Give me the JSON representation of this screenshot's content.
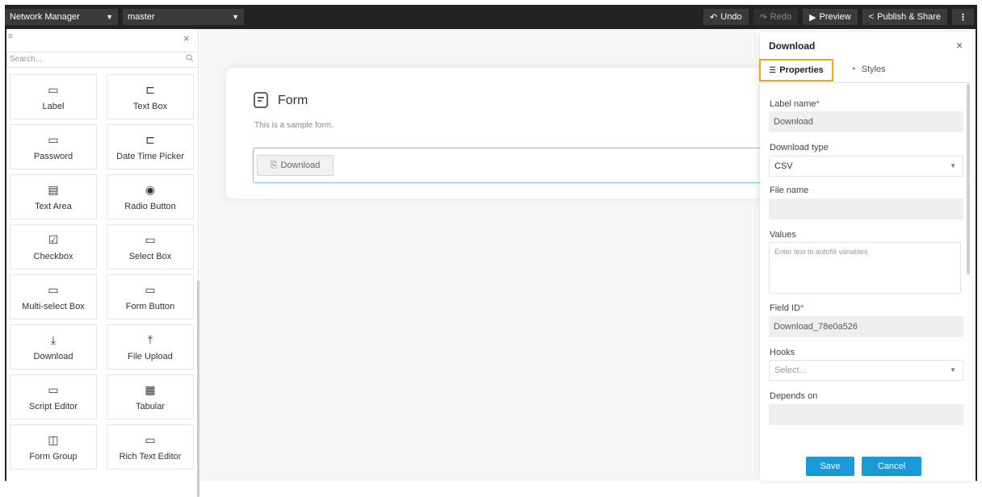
{
  "topbar": {
    "app_select": "Network Manager",
    "branch_select": "master",
    "undo": "Undo",
    "redo": "Redo",
    "preview": "Preview",
    "publish": "Publish & Share",
    "more": "⋮"
  },
  "sidebar": {
    "search_placeholder": "Search...",
    "components": [
      {
        "label": "Label",
        "icon": "label-icon"
      },
      {
        "label": "Text Box",
        "icon": "textbox-icon"
      },
      {
        "label": "Password",
        "icon": "password-icon"
      },
      {
        "label": "Date Time Picker",
        "icon": "datetime-icon"
      },
      {
        "label": "Text Area",
        "icon": "textarea-icon"
      },
      {
        "label": "Radio Button",
        "icon": "radio-icon"
      },
      {
        "label": "Checkbox",
        "icon": "checkbox-icon"
      },
      {
        "label": "Select Box",
        "icon": "selectbox-icon"
      },
      {
        "label": "Multi-select Box",
        "icon": "multiselect-icon"
      },
      {
        "label": "Form Button",
        "icon": "formbutton-icon"
      },
      {
        "label": "Download",
        "icon": "download-icon"
      },
      {
        "label": "File Upload",
        "icon": "upload-icon"
      },
      {
        "label": "Script Editor",
        "icon": "script-editor-icon"
      },
      {
        "label": "Tabular",
        "icon": "table-icon"
      },
      {
        "label": "Form Group",
        "icon": "form-group-icon"
      },
      {
        "label": "Rich Text Editor",
        "icon": "richtext-icon"
      }
    ]
  },
  "canvas": {
    "form_title": "Form",
    "form_description": "This is a sample form.",
    "download_button": "Download"
  },
  "panel": {
    "title": "Download",
    "tab_properties": "Properties",
    "tab_styles": "Styles",
    "label_name": "Label name",
    "label_name_value": "Download",
    "download_type": "Download type",
    "download_type_value": "CSV",
    "file_name": "File name",
    "file_name_value": "",
    "values": "Values",
    "values_placeholder": "Enter text to autofill variables",
    "field_id": "Field ID",
    "field_id_value": "Download_78e0a526",
    "hooks": "Hooks",
    "hooks_placeholder": "Select...",
    "depends_on": "Depends on",
    "depends_on_value": "",
    "save": "Save",
    "cancel": "Cancel",
    "required_mark": "*"
  },
  "colors": {
    "topbar": "#222222",
    "accent": "#1a9ad6",
    "tab_highlight": "#f3a41e",
    "dropzone_border": "#76c6dc",
    "required": "#e23b3b"
  }
}
